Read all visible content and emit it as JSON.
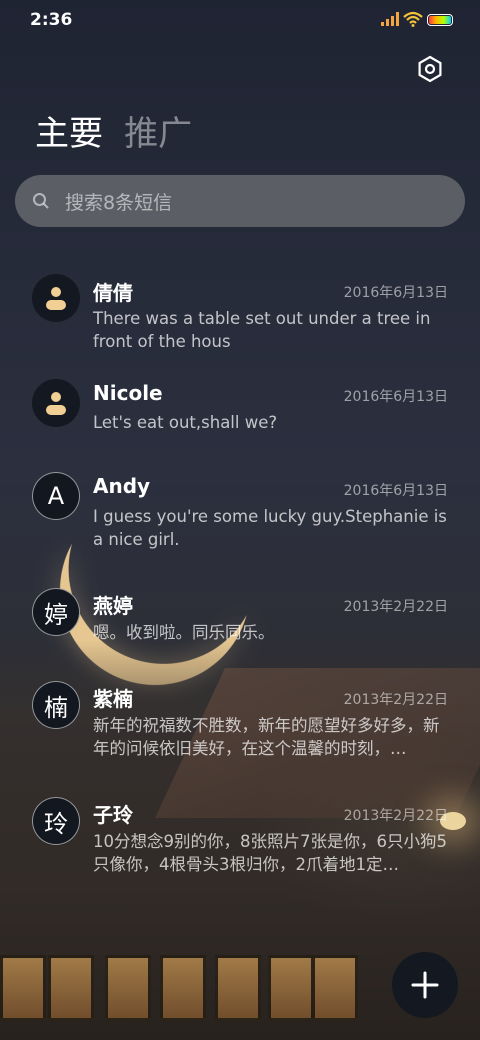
{
  "status_bar": {
    "time": "2:36"
  },
  "tabs": [
    {
      "label": "主要",
      "active": true
    },
    {
      "label": "推广",
      "active": false
    }
  ],
  "search": {
    "placeholder": "搜索8条短信"
  },
  "conversations": [
    {
      "avatar": "person-icon",
      "name": "倩倩",
      "date": "2016年6月13日",
      "message": "There was a table set out under a tree in front of the hous"
    },
    {
      "avatar": "person-icon",
      "name": "Nicole",
      "date": "2016年6月13日",
      "message": "Let's eat out,shall we?"
    },
    {
      "avatar": "A",
      "name": "Andy",
      "date": "2016年6月13日",
      "message": "I guess you're some lucky guy.Stephanie is a nice girl."
    },
    {
      "avatar": "婷",
      "name": "燕婷",
      "date": "2013年2月22日",
      "message": "嗯。收到啦。同乐同乐。"
    },
    {
      "avatar": "楠",
      "name": "紫楠",
      "date": "2013年2月22日",
      "message": "新年的祝福数不胜数，新年的愿望好多好多，新年的问候依旧美好，在这个温馨的时刻，…"
    },
    {
      "avatar": "玲",
      "name": "子玲",
      "date": "2013年2月22日",
      "message": "10分想念9别的你，8张照片7张是你，6只小狗5只像你，4根骨头3根归你，2爪着地1定…"
    }
  ],
  "icons": {
    "settings": "settings-hexagon-icon",
    "search": "search-icon",
    "compose": "plus-icon"
  },
  "colors": {
    "background_top": "#1f2433",
    "accent_moon": "#eecd96"
  }
}
